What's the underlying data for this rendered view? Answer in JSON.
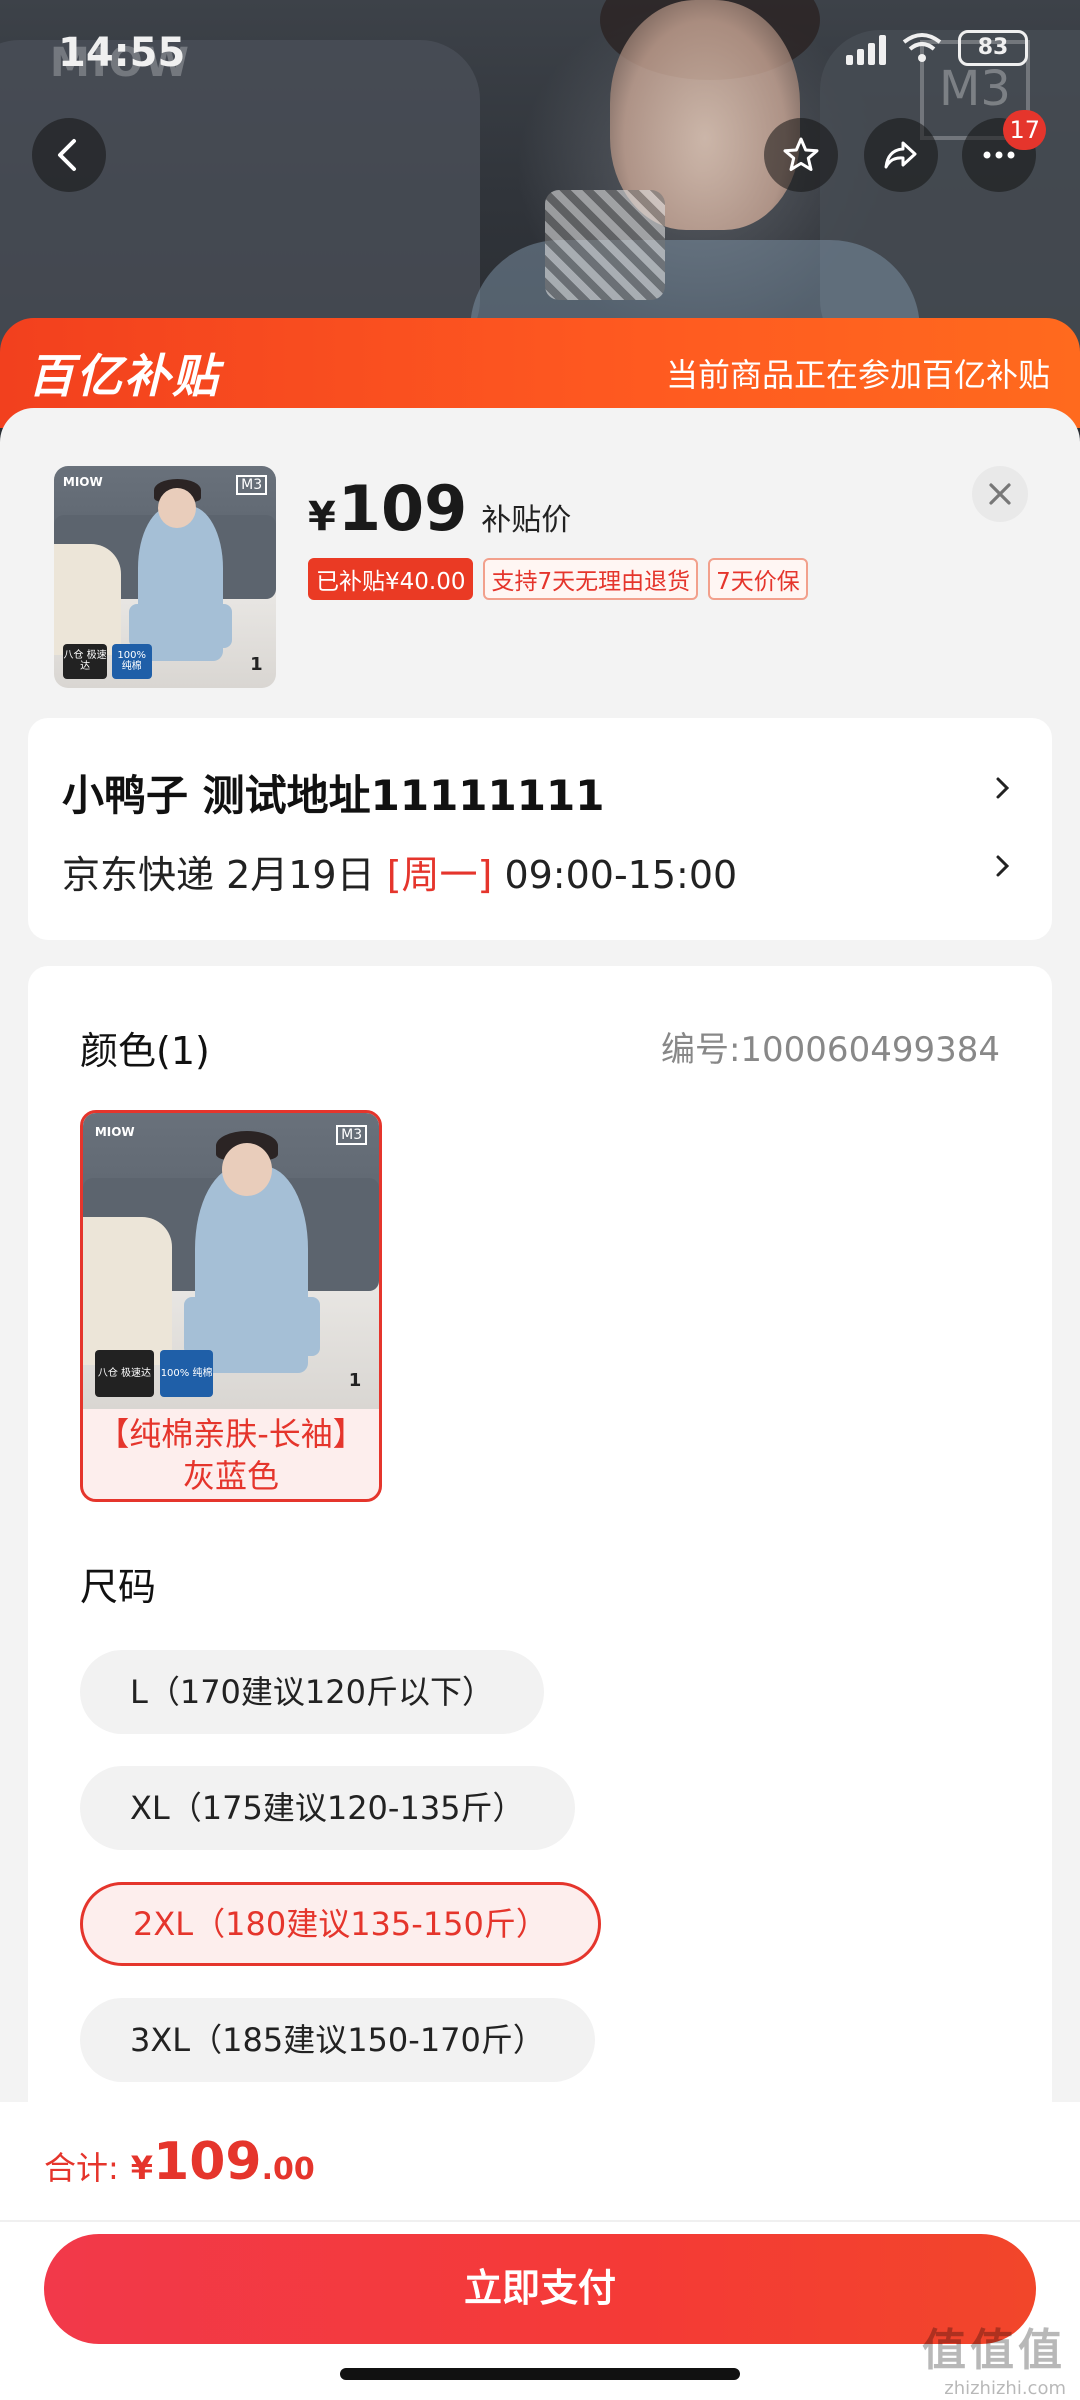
{
  "status_bar": {
    "time": "14:55",
    "battery": "83"
  },
  "hero": {
    "brand_left": "MIOW",
    "brand_right": "M3",
    "cart_badge": "17"
  },
  "banner": {
    "logo": "百亿补贴",
    "text": "当前商品正在参加百亿补贴"
  },
  "product": {
    "currency": "¥",
    "price": "109",
    "price_label": "补贴价",
    "tags": [
      "已补贴¥40.00",
      "支持7天无理由退货",
      "7天价保"
    ],
    "image_logo": "MIOW",
    "image_badge_1": "八仓 极速达",
    "image_badge_2": "100% 纯棉",
    "image_qty": "1",
    "image_m3": "M3"
  },
  "address": {
    "line1": "小鸭子  测试地址11111111",
    "delivery_prefix": "京东快递 2月19日 ",
    "delivery_day": "[周一]",
    "delivery_time": " 09:00-15:00"
  },
  "options": {
    "color_title": "颜色(1)",
    "code": "编号:100060499384",
    "color_items": [
      {
        "label": "【纯棉亲肤-长袖】灰蓝色",
        "selected": true
      }
    ],
    "size_title": "尺码",
    "sizes": [
      {
        "label": "L（170建议120斤以下）",
        "selected": false
      },
      {
        "label": "XL（175建议120-135斤）",
        "selected": false
      },
      {
        "label": "2XL（180建议135-150斤）",
        "selected": true
      },
      {
        "label": "3XL（185建议150-170斤）",
        "selected": false
      }
    ]
  },
  "footer": {
    "total_label": "合计:",
    "total_currency": "¥",
    "total_int": "109",
    "total_dec": ".00",
    "pay_label": "立即支付"
  },
  "watermark": {
    "main": "值值值",
    "sub": "zhizhizhi.com"
  },
  "colors": {
    "accent": "#e5352c",
    "banner": "#f2401e",
    "pay_button": "#f43a36"
  }
}
